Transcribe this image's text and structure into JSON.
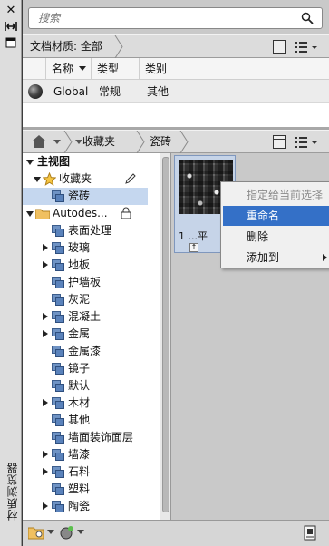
{
  "palette": {
    "title": "材质浏览器"
  },
  "search": {
    "placeholder": "搜索"
  },
  "doc_filter": {
    "label": "文档材质: 全部"
  },
  "doc_table": {
    "columns": [
      "名称",
      "类型",
      "类别"
    ],
    "rows": [
      {
        "name": "Global",
        "type": "常规",
        "category": "其他"
      }
    ]
  },
  "library_breadcrumb": {
    "items": [
      "收藏夹",
      "瓷砖"
    ]
  },
  "tree": {
    "root": "主视图",
    "favorites": "收藏夹",
    "favorites_child": "瓷砖",
    "autodesk": "Autodes...",
    "categories": [
      "表面处理",
      "玻璃",
      "地板",
      "护墙板",
      "灰泥",
      "混凝土",
      "金属",
      "金属漆",
      "镜子",
      "默认",
      "木材",
      "其他",
      "墙面装饰面层",
      "墙漆",
      "石料",
      "塑料",
      "陶瓷"
    ]
  },
  "swatch": {
    "name": "1 ...平"
  },
  "context_menu": {
    "items": [
      "指定给当前选择",
      "重命名",
      "删除",
      "添加到"
    ]
  },
  "colors": {
    "selection": "#3470c7",
    "tree_selection": "#c5d7ef"
  }
}
